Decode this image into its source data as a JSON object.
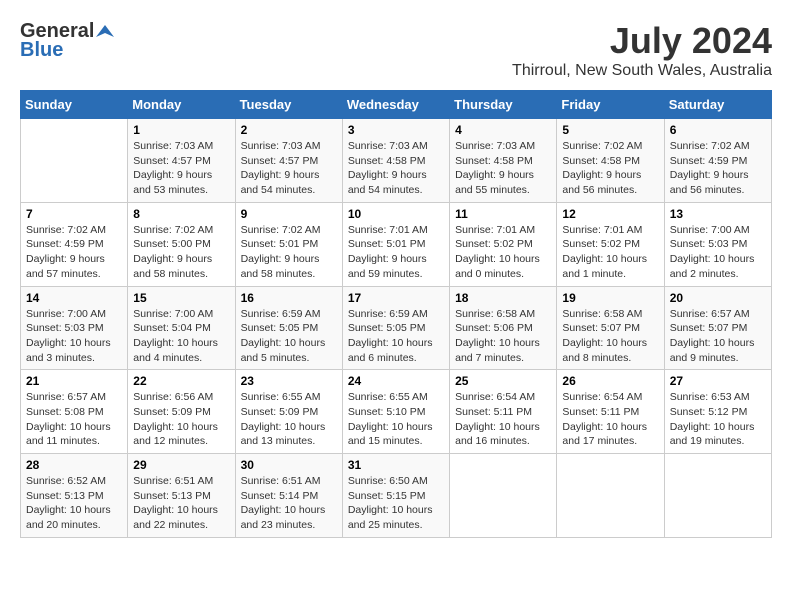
{
  "logo": {
    "general": "General",
    "blue": "Blue"
  },
  "title": {
    "month_year": "July 2024",
    "location": "Thirroul, New South Wales, Australia"
  },
  "days_of_week": [
    "Sunday",
    "Monday",
    "Tuesday",
    "Wednesday",
    "Thursday",
    "Friday",
    "Saturday"
  ],
  "weeks": [
    [
      {
        "day": "",
        "info": ""
      },
      {
        "day": "1",
        "info": "Sunrise: 7:03 AM\nSunset: 4:57 PM\nDaylight: 9 hours\nand 53 minutes."
      },
      {
        "day": "2",
        "info": "Sunrise: 7:03 AM\nSunset: 4:57 PM\nDaylight: 9 hours\nand 54 minutes."
      },
      {
        "day": "3",
        "info": "Sunrise: 7:03 AM\nSunset: 4:58 PM\nDaylight: 9 hours\nand 54 minutes."
      },
      {
        "day": "4",
        "info": "Sunrise: 7:03 AM\nSunset: 4:58 PM\nDaylight: 9 hours\nand 55 minutes."
      },
      {
        "day": "5",
        "info": "Sunrise: 7:02 AM\nSunset: 4:58 PM\nDaylight: 9 hours\nand 56 minutes."
      },
      {
        "day": "6",
        "info": "Sunrise: 7:02 AM\nSunset: 4:59 PM\nDaylight: 9 hours\nand 56 minutes."
      }
    ],
    [
      {
        "day": "7",
        "info": "Sunrise: 7:02 AM\nSunset: 4:59 PM\nDaylight: 9 hours\nand 57 minutes."
      },
      {
        "day": "8",
        "info": "Sunrise: 7:02 AM\nSunset: 5:00 PM\nDaylight: 9 hours\nand 58 minutes."
      },
      {
        "day": "9",
        "info": "Sunrise: 7:02 AM\nSunset: 5:01 PM\nDaylight: 9 hours\nand 58 minutes."
      },
      {
        "day": "10",
        "info": "Sunrise: 7:01 AM\nSunset: 5:01 PM\nDaylight: 9 hours\nand 59 minutes."
      },
      {
        "day": "11",
        "info": "Sunrise: 7:01 AM\nSunset: 5:02 PM\nDaylight: 10 hours\nand 0 minutes."
      },
      {
        "day": "12",
        "info": "Sunrise: 7:01 AM\nSunset: 5:02 PM\nDaylight: 10 hours\nand 1 minute."
      },
      {
        "day": "13",
        "info": "Sunrise: 7:00 AM\nSunset: 5:03 PM\nDaylight: 10 hours\nand 2 minutes."
      }
    ],
    [
      {
        "day": "14",
        "info": "Sunrise: 7:00 AM\nSunset: 5:03 PM\nDaylight: 10 hours\nand 3 minutes."
      },
      {
        "day": "15",
        "info": "Sunrise: 7:00 AM\nSunset: 5:04 PM\nDaylight: 10 hours\nand 4 minutes."
      },
      {
        "day": "16",
        "info": "Sunrise: 6:59 AM\nSunset: 5:05 PM\nDaylight: 10 hours\nand 5 minutes."
      },
      {
        "day": "17",
        "info": "Sunrise: 6:59 AM\nSunset: 5:05 PM\nDaylight: 10 hours\nand 6 minutes."
      },
      {
        "day": "18",
        "info": "Sunrise: 6:58 AM\nSunset: 5:06 PM\nDaylight: 10 hours\nand 7 minutes."
      },
      {
        "day": "19",
        "info": "Sunrise: 6:58 AM\nSunset: 5:07 PM\nDaylight: 10 hours\nand 8 minutes."
      },
      {
        "day": "20",
        "info": "Sunrise: 6:57 AM\nSunset: 5:07 PM\nDaylight: 10 hours\nand 9 minutes."
      }
    ],
    [
      {
        "day": "21",
        "info": "Sunrise: 6:57 AM\nSunset: 5:08 PM\nDaylight: 10 hours\nand 11 minutes."
      },
      {
        "day": "22",
        "info": "Sunrise: 6:56 AM\nSunset: 5:09 PM\nDaylight: 10 hours\nand 12 minutes."
      },
      {
        "day": "23",
        "info": "Sunrise: 6:55 AM\nSunset: 5:09 PM\nDaylight: 10 hours\nand 13 minutes."
      },
      {
        "day": "24",
        "info": "Sunrise: 6:55 AM\nSunset: 5:10 PM\nDaylight: 10 hours\nand 15 minutes."
      },
      {
        "day": "25",
        "info": "Sunrise: 6:54 AM\nSunset: 5:11 PM\nDaylight: 10 hours\nand 16 minutes."
      },
      {
        "day": "26",
        "info": "Sunrise: 6:54 AM\nSunset: 5:11 PM\nDaylight: 10 hours\nand 17 minutes."
      },
      {
        "day": "27",
        "info": "Sunrise: 6:53 AM\nSunset: 5:12 PM\nDaylight: 10 hours\nand 19 minutes."
      }
    ],
    [
      {
        "day": "28",
        "info": "Sunrise: 6:52 AM\nSunset: 5:13 PM\nDaylight: 10 hours\nand 20 minutes."
      },
      {
        "day": "29",
        "info": "Sunrise: 6:51 AM\nSunset: 5:13 PM\nDaylight: 10 hours\nand 22 minutes."
      },
      {
        "day": "30",
        "info": "Sunrise: 6:51 AM\nSunset: 5:14 PM\nDaylight: 10 hours\nand 23 minutes."
      },
      {
        "day": "31",
        "info": "Sunrise: 6:50 AM\nSunset: 5:15 PM\nDaylight: 10 hours\nand 25 minutes."
      },
      {
        "day": "",
        "info": ""
      },
      {
        "day": "",
        "info": ""
      },
      {
        "day": "",
        "info": ""
      }
    ]
  ]
}
